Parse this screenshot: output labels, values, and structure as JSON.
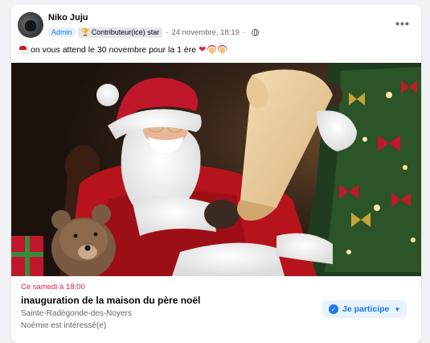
{
  "post": {
    "author": "Niko Juju",
    "badges": {
      "admin": "Admin",
      "contributor": "Contributeur(ice) star"
    },
    "timestamp": "24 novembre, 18:19",
    "separator": "·",
    "text": "on vous attend le 30 novembre pour la 1 ère",
    "more_label": "•••"
  },
  "event": {
    "when": "Ce samedi à 18:00",
    "title": "inauguration de la maison du père noël",
    "location": "Sainte-Radégonde-des-Noyers",
    "interested": "Noémie est intéressé(e)",
    "going_label": "Je participe"
  },
  "icons": {
    "avatar": "avatar-icon",
    "trophy": "trophy-icon",
    "globe": "globe-icon",
    "more": "more-options-icon",
    "hat": "santa-hat-icon",
    "heart": "heart-icon",
    "santa": "santa-face-icon",
    "check": "check-icon",
    "chevron": "chevron-down-icon"
  },
  "colors": {
    "accent": "#1877f2",
    "event_date": "#e41e3f",
    "secondary_text": "#65676b"
  }
}
